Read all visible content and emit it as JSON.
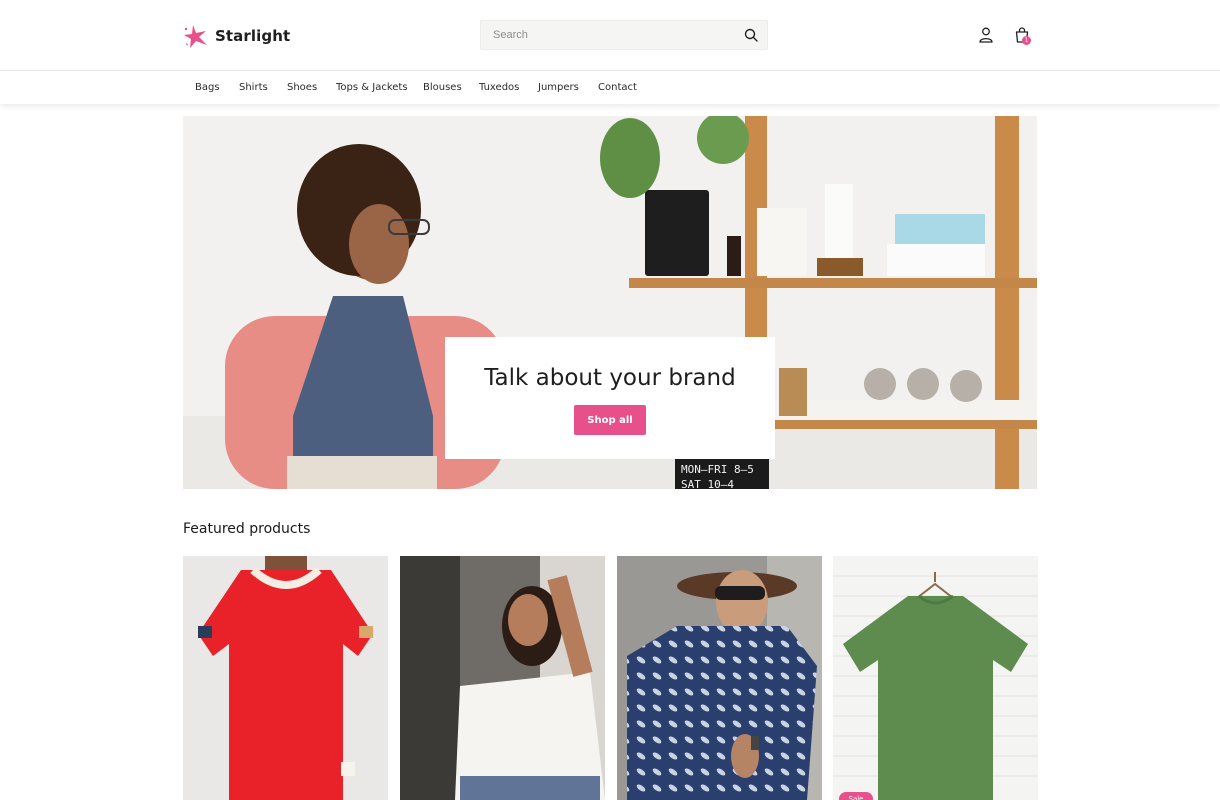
{
  "brand": {
    "name": "Starlight",
    "accent": "#e8508b"
  },
  "header": {
    "search": {
      "placeholder": "Search",
      "icon": "search-icon"
    },
    "account_icon": "user-icon",
    "cart": {
      "icon": "shopping-bag-icon",
      "count": "1"
    }
  },
  "nav": {
    "items": [
      {
        "label": "Bags"
      },
      {
        "label": "Shirts"
      },
      {
        "label": "Shoes"
      },
      {
        "label": "Tops & Jackets"
      },
      {
        "label": "Blouses"
      },
      {
        "label": "Tuxedos"
      },
      {
        "label": "Jumpers"
      },
      {
        "label": "Contact"
      }
    ]
  },
  "hero": {
    "title": "Talk about your brand",
    "button": "Shop all",
    "sign_line1": "MON—FRI 8—5",
    "sign_line2": "SAT 10—4"
  },
  "featured": {
    "title": "Featured products",
    "products": [
      {
        "image": "red-tshirt-photo"
      },
      {
        "image": "white-blouse-photo"
      },
      {
        "image": "patterned-shirt-photo"
      },
      {
        "image": "green-tshirt-photo",
        "badge": "Sale"
      }
    ]
  }
}
